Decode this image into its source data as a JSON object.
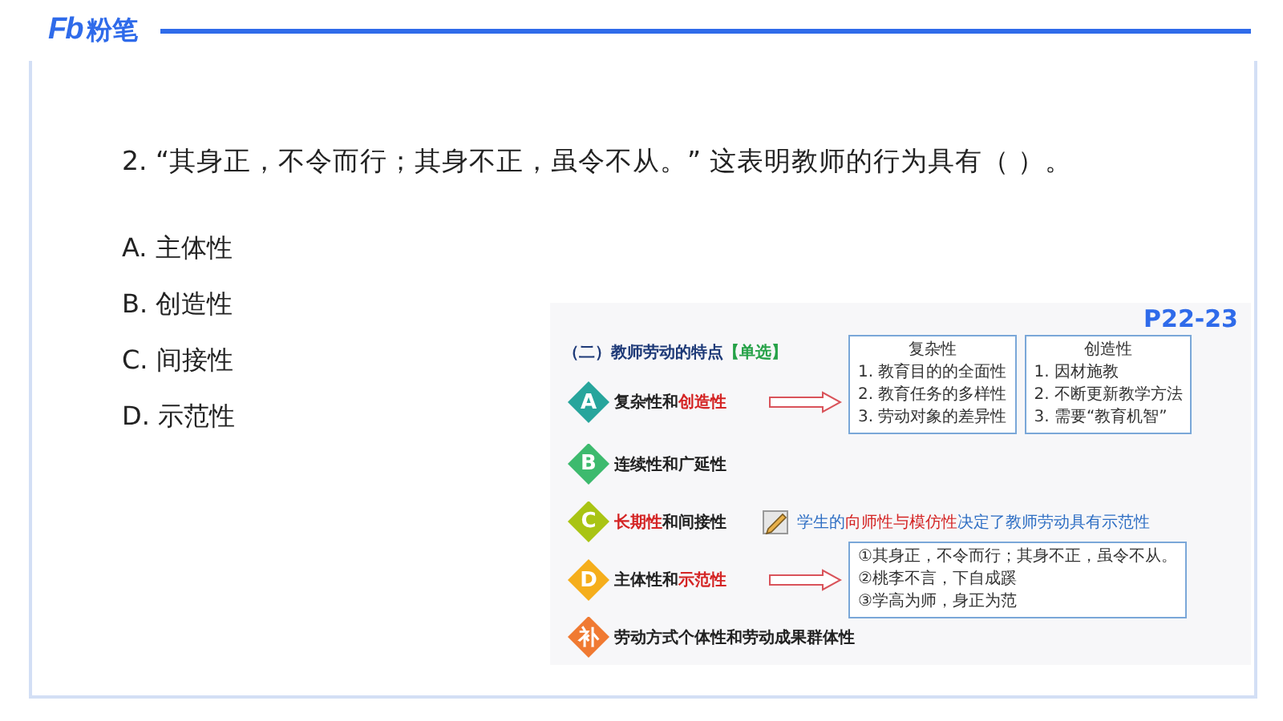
{
  "header": {
    "logo_mark": "Fb",
    "logo_text": "粉笔"
  },
  "question": {
    "text": "2. “其身正，不令而行；其身不正，虽令不从。” 这表明教师的行为具有（ ）。",
    "options": [
      "A. 主体性",
      "B. 创造性",
      "C. 间接性",
      "D. 示范性"
    ]
  },
  "slide": {
    "page_ref": "P22-23",
    "heading": "（二）教师劳动的特点",
    "tag": "【单选】",
    "items": [
      {
        "badge": "A",
        "color": "#27a59c",
        "label": "复杂性和**创造性**",
        "arrow": true,
        "boxes": [
          {
            "title": "复杂性",
            "lines": [
              "1.  教育目的的全面性",
              "2.  教育任务的多样性",
              "3.  劳动对象的差异性"
            ]
          },
          {
            "title": "创造性",
            "lines": [
              "1.  因材施教",
              "2.  不断更新教学方法",
              "3.  需要“教育机智”"
            ]
          }
        ]
      },
      {
        "badge": "B",
        "color": "#3dba6e",
        "label": "连续性和广延性",
        "arrow": false
      },
      {
        "badge": "C",
        "color": "#a9c414",
        "label": "**长期性**和间接性",
        "arrow": false,
        "note": "学生的**向师性与模仿性**决定了教师劳动具有示范性"
      },
      {
        "badge": "D",
        "color": "#f5ae1c",
        "label": "主体性和**示范性**",
        "arrow": true,
        "boxes": [
          {
            "lines": [
              "①其身正，不令而行；其身不正，虽令不从。",
              "②桃李不言，下自成蹊",
              "③学高为师，身正为范"
            ]
          }
        ]
      },
      {
        "badge": "补",
        "color": "#f07a32",
        "label": "劳动方式个体性和劳动成果群体性",
        "arrow": false
      }
    ]
  }
}
